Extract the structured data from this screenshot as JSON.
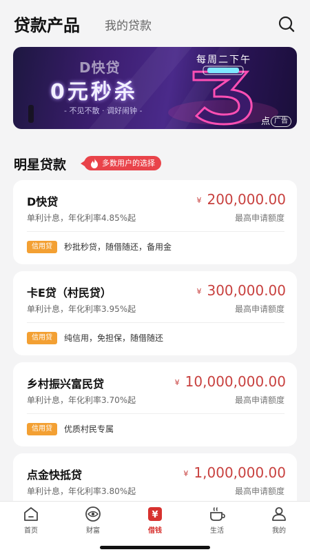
{
  "header": {
    "title": "贷款产品",
    "tab2": "我的贷款",
    "search_icon": "search-icon"
  },
  "banner": {
    "top_text": "D快贷",
    "main_text": "0元秒杀",
    "sub_text": "- 不见不散 · 调好闹钟 -",
    "week_text": "每周二下午",
    "dian": "点",
    "ad": "广告",
    "colors": {
      "bg": "#3b1d6e",
      "neon": "#e0409c"
    }
  },
  "section": {
    "title": "明星贷款",
    "badge": "多数用户的选择",
    "badge_icon": "flame-icon"
  },
  "products": [
    {
      "name": "D快贷",
      "currency": "¥",
      "amount": "200,000.00",
      "rate": "单利计息，年化利率4.85%起",
      "quota_label": "最高申请额度",
      "tag": "信用贷",
      "features": "秒批秒贷，随借随还，备用金"
    },
    {
      "name": "卡E贷（村民贷）",
      "currency": "¥",
      "amount": "300,000.00",
      "rate": "单利计息，年化利率3.95%起",
      "quota_label": "最高申请额度",
      "tag": "信用贷",
      "features": "纯信用，免担保，随借随还"
    },
    {
      "name": "乡村振兴富民贷",
      "currency": "¥",
      "amount": "10,000,000.00",
      "rate": "单利计息，年化利率3.70%起",
      "quota_label": "最高申请额度",
      "tag": "信用贷",
      "features": "优质村民专属"
    },
    {
      "name": "点金快抵贷",
      "currency": "¥",
      "amount": "1,000,000.00",
      "rate": "单利计息，年化利率3.80%起",
      "quota_label": "最高申请额度",
      "tag": "",
      "features": ""
    }
  ],
  "tabbar": [
    {
      "label": "首页",
      "icon": "home-icon"
    },
    {
      "label": "财富",
      "icon": "eye-icon"
    },
    {
      "label": "借钱",
      "icon": "yen-icon",
      "active": true
    },
    {
      "label": "生活",
      "icon": "cup-icon"
    },
    {
      "label": "我的",
      "icon": "user-icon"
    }
  ],
  "colors": {
    "accent": "#c8413f",
    "tag": "#f3a033",
    "badge": "#e9434a"
  }
}
